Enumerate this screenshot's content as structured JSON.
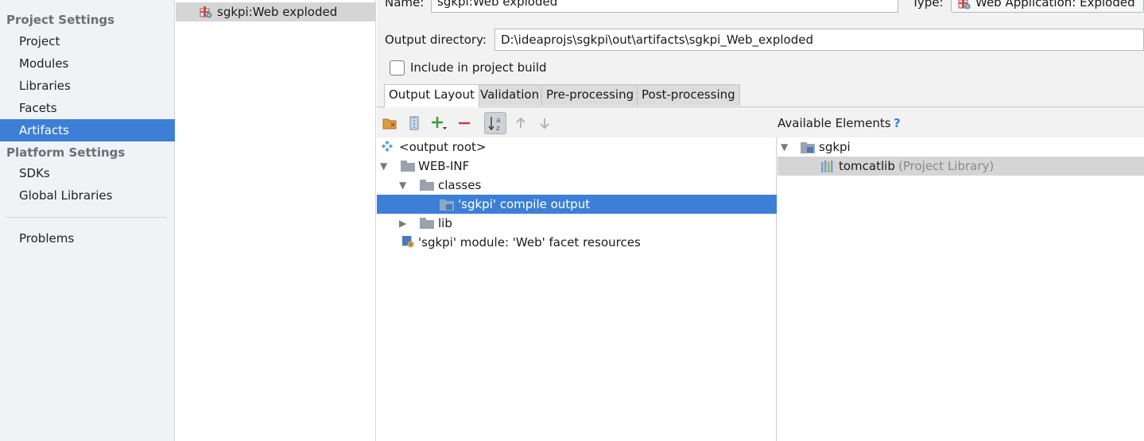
{
  "sidebar": {
    "project_settings_header": "Project Settings",
    "platform_settings_header": "Platform Settings",
    "items": [
      {
        "label": "Project"
      },
      {
        "label": "Modules"
      },
      {
        "label": "Libraries"
      },
      {
        "label": "Facets"
      },
      {
        "label": "Artifacts",
        "selected": true
      },
      {
        "label": "SDKs"
      },
      {
        "label": "Global Libraries"
      },
      {
        "label": "Problems"
      }
    ]
  },
  "artifacts": {
    "items": [
      {
        "label": "sgkpi:Web exploded",
        "icon": "web-artifact-icon"
      }
    ]
  },
  "config": {
    "name_label": "Name:",
    "name_value": "sgkpi:Web exploded",
    "type_label": "Type:",
    "type_value": "Web Application: Exploded",
    "output_dir_label": "Output directory:",
    "output_dir_value": "D:\\ideaprojs\\sgkpi\\out\\artifacts\\sgkpi_Web_exploded",
    "include_label": "Include in project build",
    "include_checked": false,
    "tabs": [
      {
        "label": "Output Layout",
        "active": true
      },
      {
        "label": "Validation"
      },
      {
        "label": "Pre-processing"
      },
      {
        "label": "Post-processing"
      }
    ]
  },
  "layout_tree": {
    "toolbar_icons": [
      "create-directory-icon",
      "create-archive-icon",
      "add-copy-icon",
      "remove-icon",
      "sort-az-icon",
      "move-up-icon",
      "move-down-icon"
    ],
    "rows": [
      {
        "label": "<output root>",
        "icon": "output-root-icon"
      },
      {
        "label": "WEB-INF",
        "icon": "folder-icon",
        "expanded": true
      },
      {
        "label": "classes",
        "icon": "folder-icon",
        "expanded": true
      },
      {
        "label": "'sgkpi' compile output",
        "icon": "module-output-icon",
        "selected": true
      },
      {
        "label": "lib",
        "icon": "folder-icon",
        "expanded": false
      },
      {
        "label": "'sgkpi' module: 'Web' facet resources",
        "icon": "web-facet-icon"
      }
    ]
  },
  "available": {
    "header": "Available Elements",
    "help_symbol": "?",
    "rows": [
      {
        "label": "sgkpi",
        "icon": "module-folder-icon",
        "expanded": true
      },
      {
        "label": "tomcatlib",
        "suffix": "(Project Library)",
        "icon": "library-icon",
        "selected": true
      }
    ]
  },
  "colors": {
    "selection": "#3d7fd6",
    "sidebar_bg": "#f0f2f5",
    "panel_bg": "#f2f2f2",
    "add_green": "#3c9c3c",
    "remove_red": "#c94040"
  }
}
